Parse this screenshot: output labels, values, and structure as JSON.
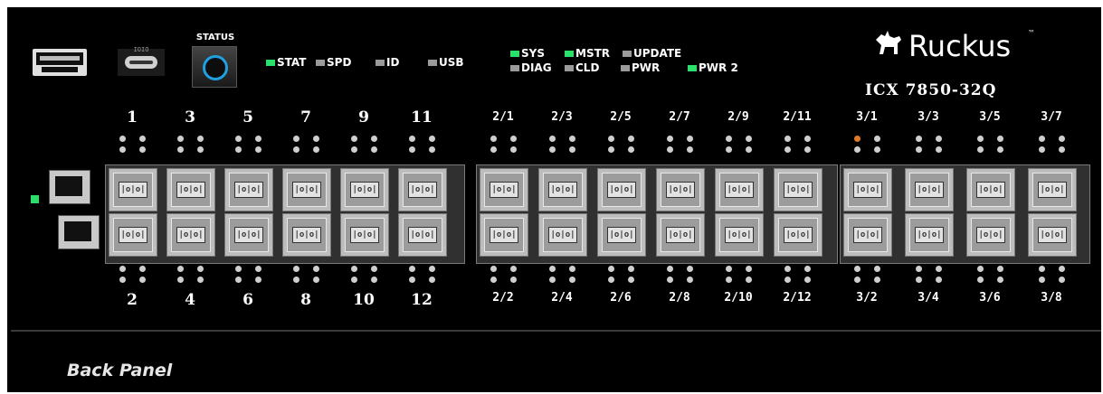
{
  "panel": {
    "logo": {
      "brand": "Ruckus",
      "tm": "™"
    },
    "model": "ICX 7850-32Q",
    "footer_label": "Back Panel"
  },
  "front": {
    "usbc_label": "IOIO",
    "status_label": "STATUS",
    "leds": [
      {
        "label": "STAT",
        "color": "green"
      },
      {
        "label": "SPD",
        "color": "gray"
      },
      {
        "label": "ID",
        "color": "gray"
      },
      {
        "label": "USB",
        "color": "gray"
      },
      {
        "label": "SYS",
        "color": "green"
      },
      {
        "label": "MSTR",
        "color": "green"
      },
      {
        "label": "UPDATE",
        "color": "gray"
      },
      {
        "label": "DIAG",
        "color": "gray"
      },
      {
        "label": "CLD",
        "color": "gray"
      },
      {
        "label": "PWR",
        "color": "gray"
      },
      {
        "label": "PWR 2",
        "color": "green"
      }
    ]
  },
  "ports": {
    "group1_top": [
      "1",
      "3",
      "5",
      "7",
      "9",
      "11"
    ],
    "group1_bottom": [
      "2",
      "4",
      "6",
      "8",
      "10",
      "12"
    ],
    "group2_top": [
      "2/1",
      "2/3",
      "2/5",
      "2/7",
      "2/9",
      "2/11"
    ],
    "group2_bottom": [
      "2/2",
      "2/4",
      "2/6",
      "2/8",
      "2/10",
      "2/12"
    ],
    "group3_top": [
      "3/1",
      "3/3",
      "3/5",
      "3/7"
    ],
    "group3_bottom": [
      "3/2",
      "3/4",
      "3/6",
      "3/8"
    ],
    "connector_label": "|o|o|"
  },
  "colors": {
    "led_green": "#2be06a",
    "led_orange": "#e07a2b",
    "status_ring": "#1fa0e0"
  }
}
